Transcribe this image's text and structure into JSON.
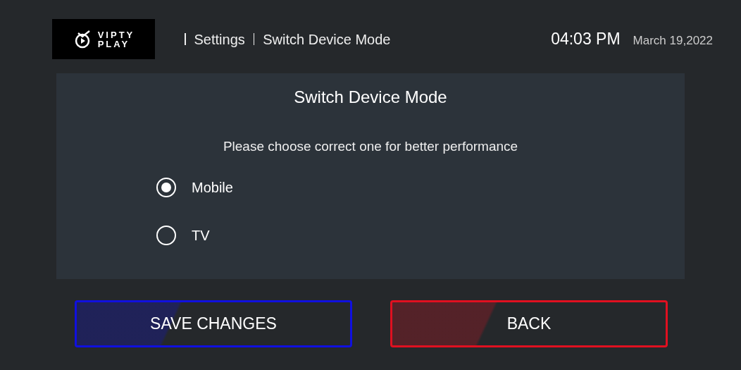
{
  "logo": {
    "line_1": "VIPTY",
    "line_2": "PLAY"
  },
  "breadcrumb": [
    "Settings",
    "Switch Device Mode"
  ],
  "time": "04:03 PM",
  "date": "March 19,2022",
  "panel": {
    "title": "Switch Device Mode",
    "subtitle": "Please choose correct one for better performance",
    "options": [
      {
        "label": "Mobile",
        "selected": true
      },
      {
        "label": "TV",
        "selected": false
      }
    ]
  },
  "buttons": [
    {
      "label": "SAVE CHANGES",
      "color": "#1010e0"
    },
    {
      "label": "BACK",
      "color": "#e01020"
    }
  ]
}
